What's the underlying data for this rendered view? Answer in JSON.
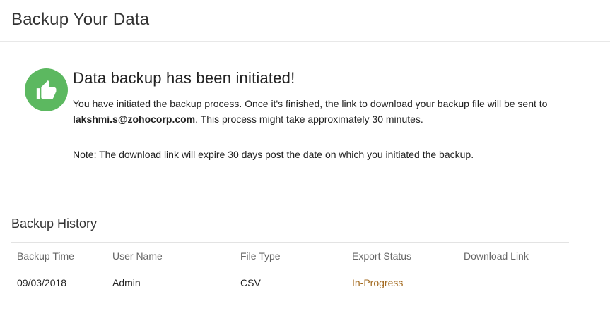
{
  "header": {
    "title": "Backup Your Data"
  },
  "notice": {
    "icon": "thumbs-up-icon",
    "icon_color": "#5cb860",
    "heading": "Data backup has been initiated!",
    "body_before_email": "You have initiated the backup process. Once it's finished, the link to download your backup file will be sent to ",
    "email": "lakshmi.s@zohocorp.com",
    "body_after_email": ". This process might take approximately 30 minutes.",
    "note": "Note: The download link will expire 30 days post the date on which you initiated the backup."
  },
  "history": {
    "title": "Backup History",
    "columns": [
      "Backup Time",
      "User Name",
      "File Type",
      "Export Status",
      "Download Link"
    ],
    "rows": [
      {
        "backup_time": "09/03/2018",
        "user_name": "Admin",
        "file_type": "CSV",
        "export_status": "In-Progress",
        "download_link": ""
      }
    ],
    "status_color": "#a36a1f"
  }
}
